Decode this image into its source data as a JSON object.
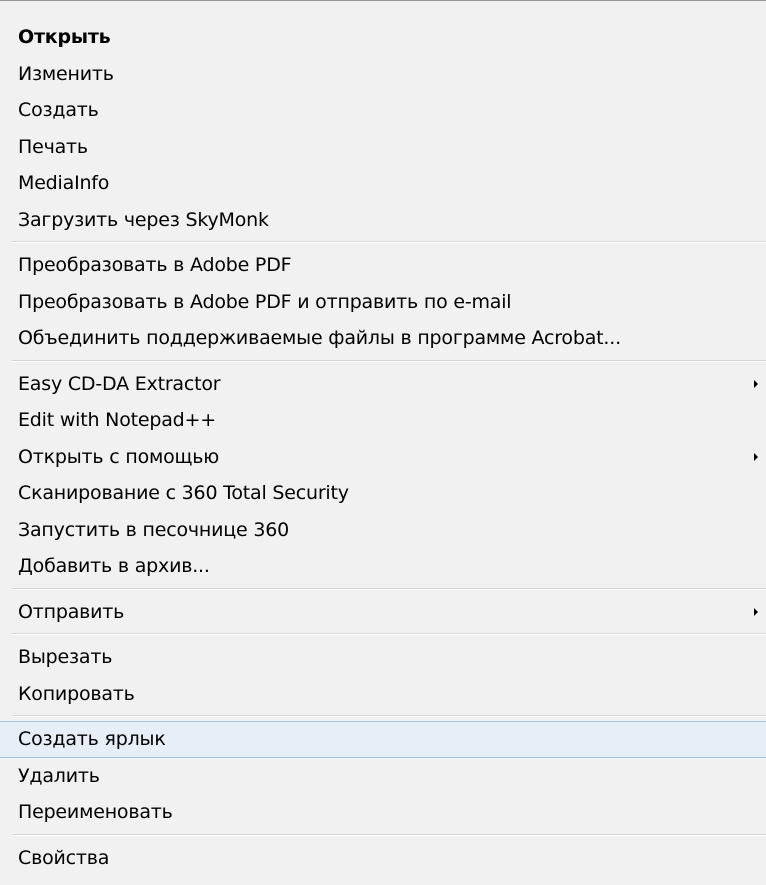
{
  "menu": {
    "groups": [
      {
        "items": [
          {
            "label": "Открыть"
          },
          {
            "label": "Изменить"
          },
          {
            "label": "Создать"
          },
          {
            "label": "Печать"
          },
          {
            "label": "MediaInfo"
          },
          {
            "label": "Загрузить через SkyMonk"
          }
        ]
      },
      {
        "items": [
          {
            "label": "Преобразовать в Adobe PDF"
          },
          {
            "label": "Преобразовать в Adobe PDF и отправить по e-mail"
          },
          {
            "label": "Объединить поддерживаемые файлы в программе Acrobat..."
          }
        ]
      },
      {
        "items": [
          {
            "label": "Easy CD-DA Extractor",
            "submenu": true
          },
          {
            "label": "Edit with Notepad++"
          },
          {
            "label": "Открыть с помощью",
            "submenu": true
          },
          {
            "label": "Сканирование с 360 Total Security"
          },
          {
            "label": "Запустить в песочнице 360"
          },
          {
            "label": "Добавить в архив..."
          }
        ]
      },
      {
        "items": [
          {
            "label": "Отправить",
            "submenu": true
          }
        ]
      },
      {
        "items": [
          {
            "label": "Вырезать"
          },
          {
            "label": "Копировать"
          }
        ]
      },
      {
        "items": [
          {
            "label": "Создать ярлык",
            "highlighted": true
          },
          {
            "label": "Удалить"
          },
          {
            "label": "Переименовать"
          }
        ]
      },
      {
        "items": [
          {
            "label": "Свойства"
          }
        ]
      }
    ],
    "submenu_arrow_icon": "chevron-right-icon",
    "highlight_color": "#e6eff8",
    "background_color": "#f1f1f1"
  }
}
